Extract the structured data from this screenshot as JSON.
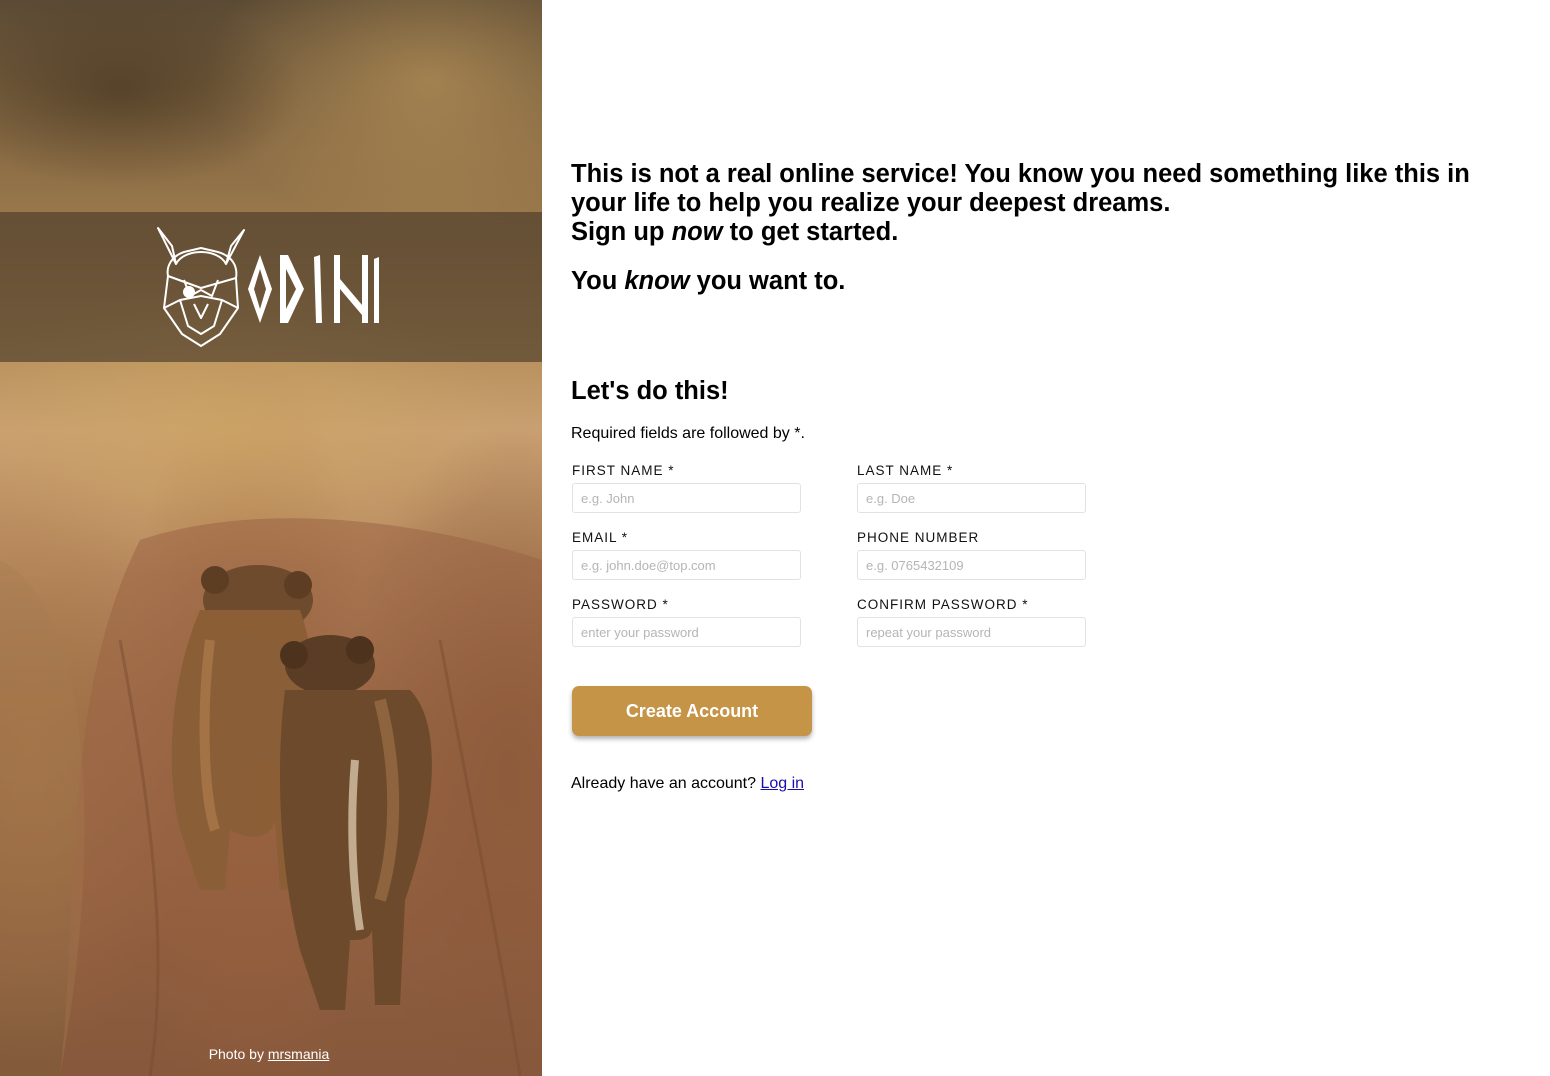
{
  "brand": {
    "logo_text": "ODIN"
  },
  "photo_credit": {
    "prefix": "Photo by",
    "author": "mrsmania"
  },
  "intro": {
    "line1": "This is not a real online service! You know you need something like this in your life to help you realize your deepest dreams.",
    "line2_before": "Sign up",
    "line2_emphasis": "now",
    "line2_after": "to get started.",
    "sub_before": "You",
    "sub_emphasis": "know",
    "sub_after": "you want to."
  },
  "form": {
    "title": "Let's do this!",
    "required_note": "Required fields are followed by *.",
    "fields": {
      "first_name": {
        "label": "FIRST NAME *",
        "placeholder": "e.g. John",
        "value": ""
      },
      "last_name": {
        "label": "LAST NAME *",
        "placeholder": "e.g. Doe",
        "value": ""
      },
      "email": {
        "label": "EMAIL *",
        "placeholder": "e.g. john.doe@top.com",
        "value": ""
      },
      "phone": {
        "label": "PHONE NUMBER",
        "placeholder": "e.g. 0765432109",
        "value": ""
      },
      "password": {
        "label": "PASSWORD *",
        "placeholder": "enter your password",
        "value": ""
      },
      "confirm_password": {
        "label": "CONFIRM PASSWORD *",
        "placeholder": "repeat your password",
        "value": ""
      }
    },
    "submit_label": "Create Account",
    "login_prompt": "Already have an account?",
    "login_link": "Log in"
  },
  "colors": {
    "accent": "#c59446",
    "link": "#1a0dab",
    "logo_band": "#463728"
  }
}
